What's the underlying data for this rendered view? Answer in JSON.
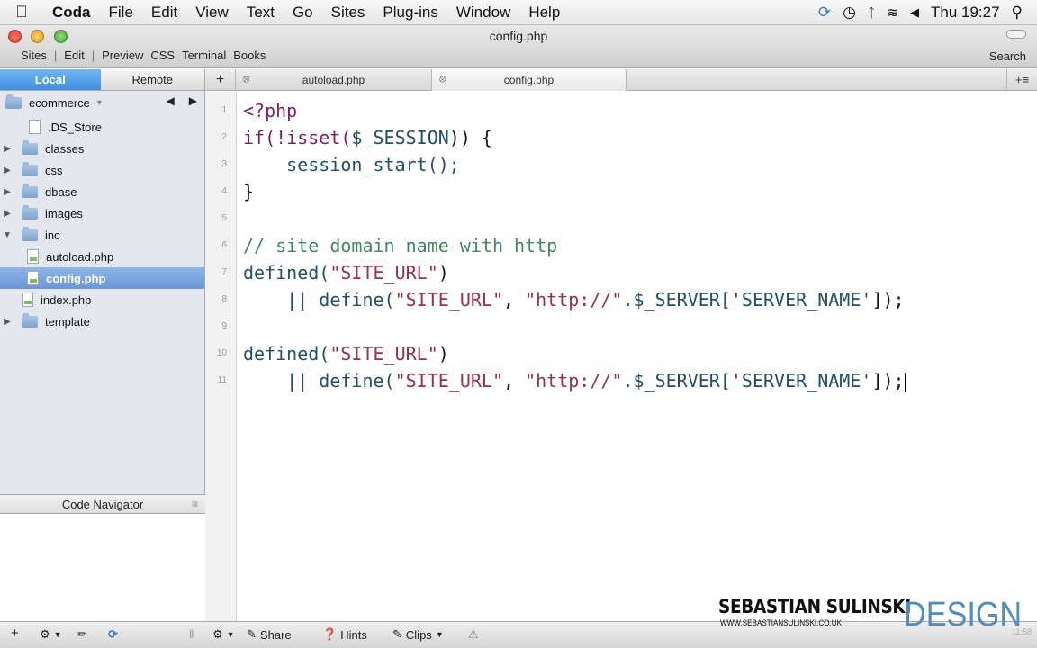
{
  "menubar": {
    "app": "Coda",
    "items": [
      "File",
      "Edit",
      "View",
      "Text",
      "Go",
      "Sites",
      "Plug-ins",
      "Window",
      "Help"
    ],
    "clock": "Thu 19:27"
  },
  "window": {
    "title": "config.php",
    "toolbar": [
      "Sites",
      "|",
      "Edit",
      "|",
      "Preview",
      "CSS",
      "Terminal",
      "Books"
    ],
    "search_label": "Search"
  },
  "sidebar": {
    "local_label": "Local",
    "remote_label": "Remote",
    "site_name": "ecommerce",
    "tree": [
      {
        "label": ".DS_Store",
        "type": "file",
        "level": 1
      },
      {
        "label": "classes",
        "type": "folder",
        "level": 0
      },
      {
        "label": "css",
        "type": "folder",
        "level": 0
      },
      {
        "label": "dbase",
        "type": "folder",
        "level": 0
      },
      {
        "label": "images",
        "type": "folder",
        "level": 0
      },
      {
        "label": "inc",
        "type": "folder-open",
        "level": 0
      },
      {
        "label": "autoload.php",
        "type": "php",
        "level": 2
      },
      {
        "label": "config.php",
        "type": "php",
        "level": 2,
        "selected": true
      },
      {
        "label": "index.php",
        "type": "php",
        "level": 1
      },
      {
        "label": "template",
        "type": "folder",
        "level": 0
      }
    ],
    "code_navigator_label": "Code Navigator"
  },
  "tabs": [
    {
      "label": "autoload.php",
      "active": false
    },
    {
      "label": "config.php",
      "active": true
    }
  ],
  "editor": {
    "line_numbers": [
      "1",
      "2",
      "3",
      "4",
      "5",
      "6",
      "7",
      "8",
      "9",
      "10",
      "11"
    ],
    "lines": [
      [
        {
          "t": "<?php",
          "c": "kw"
        }
      ],
      [
        {
          "t": "if(!isset(",
          "c": "kw"
        },
        {
          "t": "$_SESSION",
          "c": "var"
        },
        {
          "t": ")) {",
          "c": ""
        }
      ],
      [
        {
          "t": "    session_start();",
          "c": "var"
        }
      ],
      [
        {
          "t": "}",
          "c": ""
        }
      ],
      [],
      [
        {
          "t": "// site domain name with http",
          "c": "cm"
        }
      ],
      [
        {
          "t": "defined(",
          "c": "var"
        },
        {
          "t": "\"SITE_URL\"",
          "c": "str"
        },
        {
          "t": ")",
          "c": ""
        }
      ],
      [
        {
          "t": "    || define(",
          "c": "var"
        },
        {
          "t": "\"SITE_URL\"",
          "c": "str"
        },
        {
          "t": ", ",
          "c": ""
        },
        {
          "t": "\"http://\"",
          "c": "str"
        },
        {
          "t": ".$_SERVER[",
          "c": "var"
        },
        {
          "t": "'SERVER_NAME'",
          "c": "var"
        },
        {
          "t": "]);",
          "c": ""
        }
      ],
      [],
      [
        {
          "t": "defined(",
          "c": "var"
        },
        {
          "t": "\"SITE_URL\"",
          "c": "str"
        },
        {
          "t": ")",
          "c": ""
        }
      ],
      [
        {
          "t": "    || define(",
          "c": "var"
        },
        {
          "t": "\"SITE_URL\"",
          "c": "str"
        },
        {
          "t": ", ",
          "c": ""
        },
        {
          "t": "\"http://\"",
          "c": "str"
        },
        {
          "t": ".$_SERVER[",
          "c": "var"
        },
        {
          "t": "'SERVER_NAME'",
          "c": "var"
        },
        {
          "t": "]);",
          "c": ""
        }
      ]
    ]
  },
  "bottombar": {
    "share": "Share",
    "hints": "Hints",
    "clips": "Clips"
  },
  "watermark": {
    "name": "SEBASTIAN SULINSKI",
    "url": "WWW.SEBASTIANSULINSKI.CO.UK",
    "design": "DESIGN",
    "time": "11:58"
  },
  "colors": {
    "keyword": "#7b1f6a",
    "string": "#a03044",
    "variable": "#22506a",
    "comment": "#3d8a5a",
    "selection": "#6896d6",
    "design_blue": "#4f8fc0"
  }
}
